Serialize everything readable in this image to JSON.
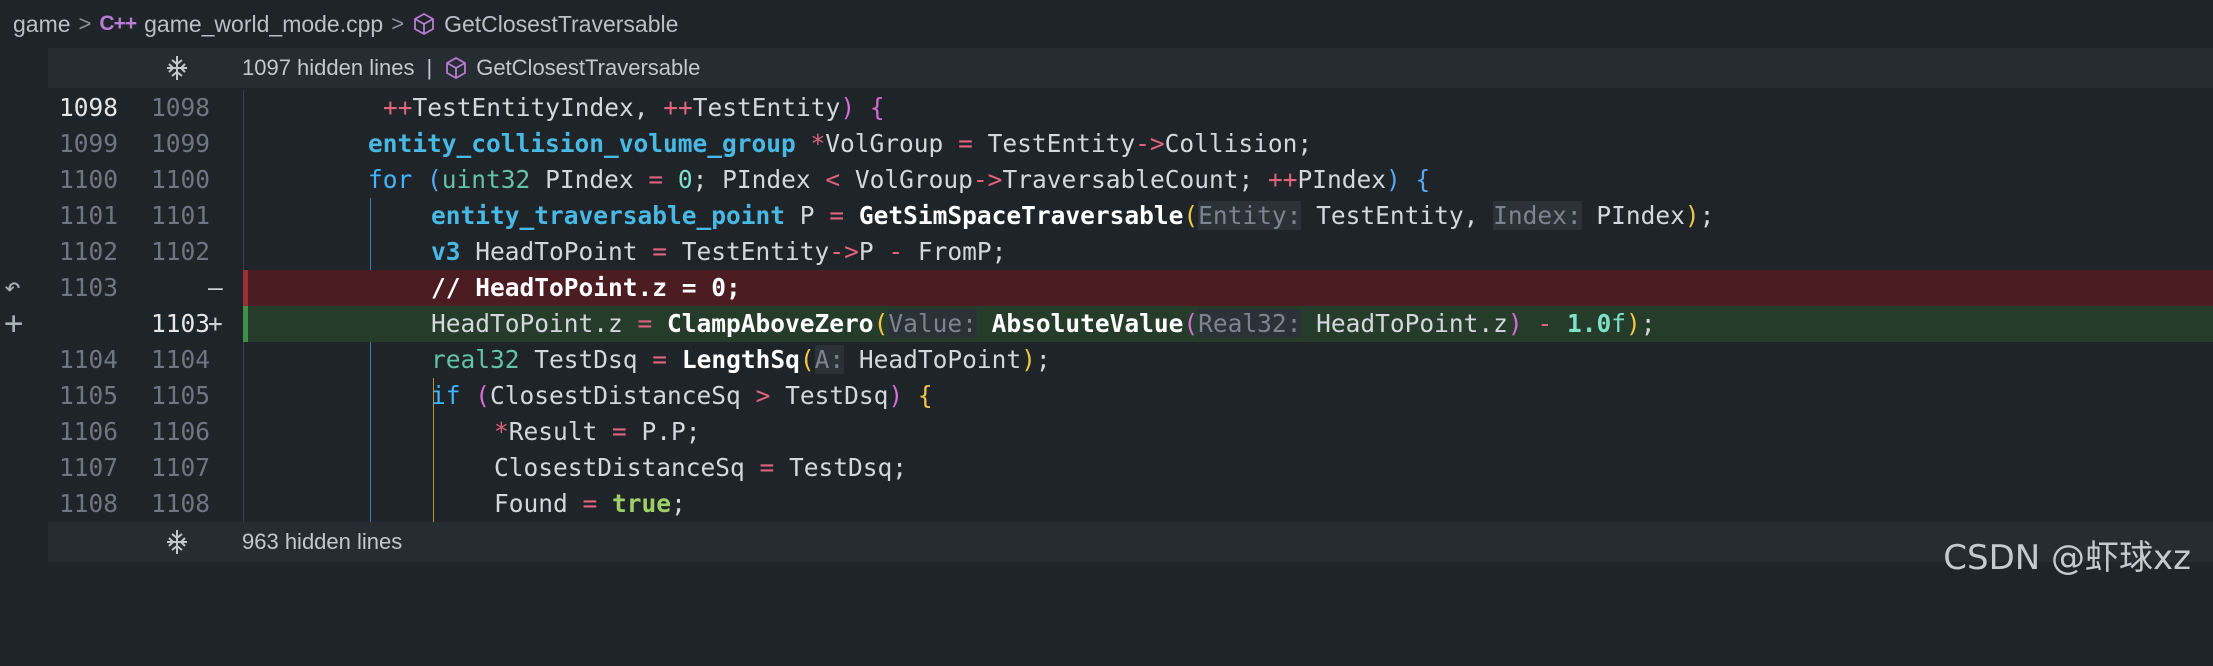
{
  "breadcrumb": {
    "folder": "game",
    "file_icon_text": "C++",
    "file": "game_world_mode.cpp",
    "symbol": "GetClosestTraversable"
  },
  "hidden_top": {
    "count_text": "1097 hidden lines",
    "separator": "|",
    "symbol": "GetClosestTraversable"
  },
  "hidden_bottom": {
    "count_text": "963 hidden lines"
  },
  "lines": [
    {
      "old": "1098",
      "new": "1098"
    },
    {
      "old": "1099",
      "new": "1099"
    },
    {
      "old": "1100",
      "new": "1100"
    },
    {
      "old": "1101",
      "new": "1101"
    },
    {
      "old": "1102",
      "new": "1102"
    },
    {
      "old": "1103",
      "new": "",
      "mark": "—"
    },
    {
      "old": "",
      "new": "1103",
      "mark": "+"
    },
    {
      "old": "1104",
      "new": "1104"
    },
    {
      "old": "1105",
      "new": "1105"
    },
    {
      "old": "1106",
      "new": "1106"
    },
    {
      "old": "1107",
      "new": "1107"
    },
    {
      "old": "1108",
      "new": "1108"
    }
  ],
  "watermark": "CSDN @虾球xz",
  "icons": {
    "expand": "expand-lines-icon",
    "revert": "revert-icon",
    "stage": "plus-icon",
    "symbol": "method-cube-icon"
  },
  "colors": {
    "background": "#1f2428",
    "deleted": "#4b1c22",
    "added": "#253c2b",
    "keyword": "#3fb4ff"
  }
}
